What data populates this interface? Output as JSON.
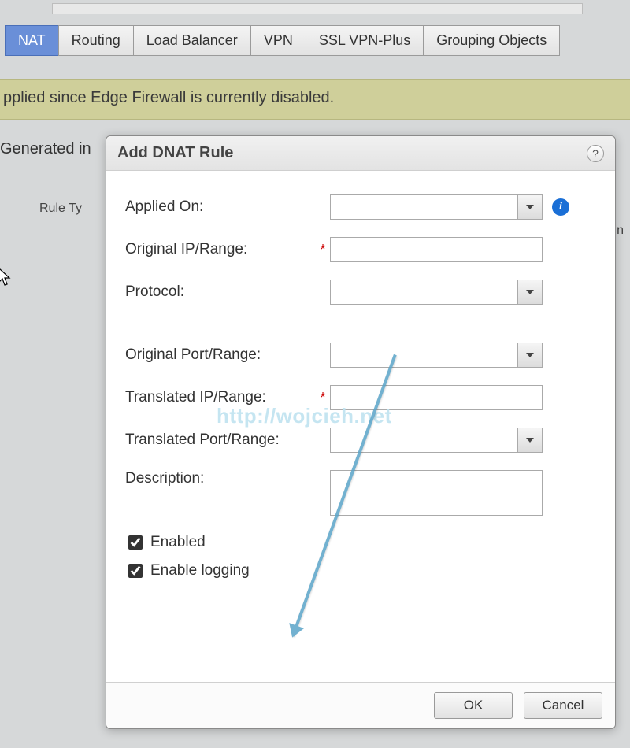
{
  "tabs": [
    "NAT",
    "Routing",
    "Load Balancer",
    "VPN",
    "SSL VPN-Plus",
    "Grouping Objects"
  ],
  "active_tab": "NAT",
  "warning": "pplied since Edge Firewall is currently disabled.",
  "generated": "Generated in",
  "column1": "Rule Ty",
  "column2": "n",
  "dialog": {
    "title": "Add DNAT Rule",
    "help": "?",
    "fields": {
      "applied_on": "Applied On:",
      "original_ip": "Original IP/Range:",
      "protocol": "Protocol:",
      "original_port": "Original Port/Range:",
      "translated_ip": "Translated IP/Range:",
      "translated_port": "Translated Port/Range:",
      "description": "Description:"
    },
    "values": {
      "applied_on": "",
      "original_ip": "",
      "protocol": "",
      "original_port": "",
      "translated_ip": "",
      "translated_port": "",
      "description": ""
    },
    "checks": {
      "enabled": {
        "label": "Enabled",
        "checked": true
      },
      "logging": {
        "label": "Enable logging",
        "checked": true
      }
    },
    "buttons": {
      "ok": "OK",
      "cancel": "Cancel"
    }
  },
  "watermark": "http://wojcieh.net"
}
